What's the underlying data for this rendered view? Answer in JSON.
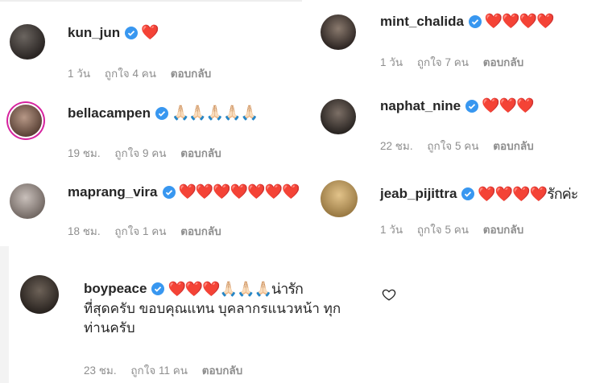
{
  "comments": [
    {
      "username": "kun_jun",
      "text": "❤️",
      "time": "1 วัน",
      "likes": "ถูกใจ 4 คน",
      "reply": "ตอบกลับ"
    },
    {
      "username": "mint_chalida",
      "text": "❤️❤️❤️❤️",
      "time": "1 วัน",
      "likes": "ถูกใจ 7 คน",
      "reply": "ตอบกลับ"
    },
    {
      "username": "bellacampen",
      "text": "🙏🏻🙏🏻🙏🏻🙏🏻🙏🏻",
      "time": "19 ชม.",
      "likes": "ถูกใจ 9 คน",
      "reply": "ตอบกลับ"
    },
    {
      "username": "naphat_nine",
      "text": "❤️❤️❤️",
      "time": "22 ชม.",
      "likes": "ถูกใจ 5 คน",
      "reply": "ตอบกลับ"
    },
    {
      "username": "maprang_vira",
      "text": "❤️❤️❤️❤️❤️❤️❤️",
      "time": "18 ชม.",
      "likes": "ถูกใจ 1 คน",
      "reply": "ตอบกลับ"
    },
    {
      "username": "jeab_pijittra",
      "text": "❤️❤️❤️❤️รักค่ะ",
      "time": "1 วัน",
      "likes": "ถูกใจ 5 คน",
      "reply": "ตอบกลับ"
    },
    {
      "username": "boypeace",
      "text_line1": "❤️❤️❤️🙏🏻🙏🏻🙏🏻น่ารัก",
      "text_rest": "ที่สุดครับ ขอบคุณแทน บุคลากรแนวหน้า ทุกท่านครับ",
      "time": "23 ชม.",
      "likes": "ถูกใจ 11 คน",
      "reply": "ตอบกลับ"
    }
  ],
  "icons": {
    "verified": "verified-badge-icon",
    "like": "heart-outline-icon"
  },
  "colors": {
    "verified_blue": "#3897f0",
    "heart_red": "#ed4956",
    "meta_gray": "#8e8e8e",
    "ring": "#d6249f"
  }
}
